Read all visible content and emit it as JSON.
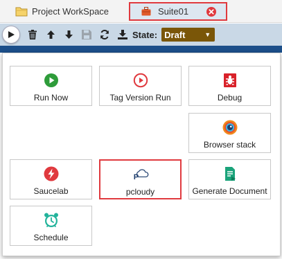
{
  "tabs": [
    {
      "label": "Project WorkSpace",
      "icon": "folder-icon"
    },
    {
      "label": "Suite01",
      "icon": "briefcase-icon"
    }
  ],
  "toolbar": {
    "state_label": "State:",
    "state_value": "Draft",
    "icons": [
      "play-icon",
      "trash-icon",
      "arrow-up-icon",
      "arrow-down-icon",
      "save-icon",
      "refresh-icon",
      "download-icon"
    ]
  },
  "menu": {
    "items": [
      {
        "label": "Run Now",
        "icon": "play-circle-icon",
        "color": "#2e9c3a"
      },
      {
        "label": "Tag Version Run",
        "icon": "play-outline-icon",
        "color": "#e0393e"
      },
      {
        "label": "Debug",
        "icon": "bug-icon",
        "color": "#d9222a"
      },
      {
        "label": "Browser stack",
        "icon": "browserstack-icon",
        "color": "#f08a1d"
      },
      {
        "label": "Saucelab",
        "icon": "saucelab-icon",
        "color": "#e0393e"
      },
      {
        "label": "pcloudy",
        "icon": "pcloudy-icon",
        "color": "#1f3f6e"
      },
      {
        "label": "Generate Document",
        "icon": "document-icon",
        "color": "#1aa37a"
      },
      {
        "label": "Schedule",
        "icon": "alarm-clock-icon",
        "color": "#22b39b"
      }
    ]
  },
  "colors": {
    "toolbar_bg": "#c9d8e6",
    "highlight": "#e0393e",
    "state_bg": "#7a5608"
  }
}
